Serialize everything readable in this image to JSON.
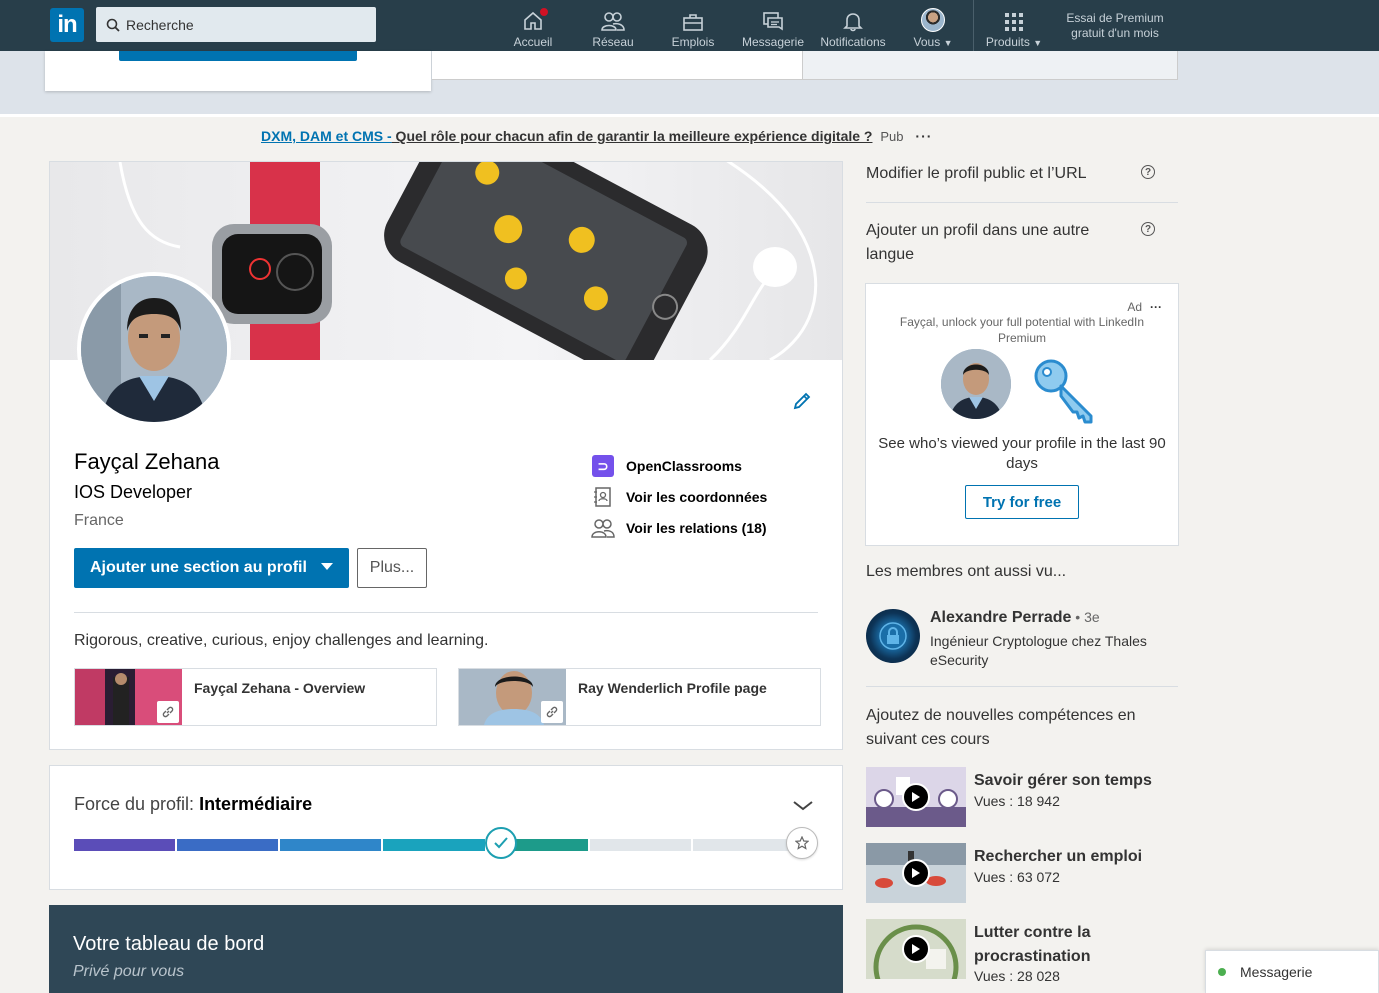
{
  "nav": {
    "logo_text": "in",
    "search_placeholder": "Recherche",
    "items": [
      {
        "label": "Accueil",
        "icon": "home-icon"
      },
      {
        "label": "Réseau",
        "icon": "network-icon"
      },
      {
        "label": "Emplois",
        "icon": "briefcase-icon"
      },
      {
        "label": "Messagerie",
        "icon": "messaging-icon"
      },
      {
        "label": "Notifications",
        "icon": "bell-icon"
      },
      {
        "label": "Vous",
        "icon": "avatar"
      },
      {
        "label": "Produits",
        "icon": "grid-icon"
      }
    ],
    "premium_line1": "Essai de Premium",
    "premium_line2": "gratuit d'un mois"
  },
  "ad_banner": {
    "part1": "DXM, DAM et CMS -",
    "part2": " Quel rôle pour chacun afin de garantir la meilleure expérience digitale ?",
    "tag": "Pub",
    "more": "···"
  },
  "profile": {
    "name": "Fayçal Zehana",
    "headline": "IOS Developer",
    "location": "France",
    "links": [
      {
        "label": "OpenClassrooms",
        "icon": "openclassrooms-icon"
      },
      {
        "label": "Voir les coordonnées",
        "icon": "contact-card-icon"
      },
      {
        "label": "Voir les relations (18)",
        "icon": "people-icon"
      }
    ],
    "add_section_label": "Ajouter une section au profil",
    "more_label": "Plus...",
    "summary": "Rigorous, creative, curious, enjoy challenges and learning.",
    "media": [
      {
        "title": "Fayçal Zehana - Overview"
      },
      {
        "title": "Ray Wenderlich Profile page"
      }
    ]
  },
  "strength": {
    "label": "Force du profil: ",
    "level": "Intermédiaire",
    "progress": 0.72,
    "segment_colors": [
      "#5b4db8",
      "#3a6cc5",
      "#2f86c9",
      "#1aa3bd",
      "#1d9b8a",
      "#e1e6ea",
      "#e1e6ea"
    ]
  },
  "dashboard": {
    "title": "Votre tableau de bord",
    "subtitle": "Privé pour vous"
  },
  "right": {
    "public_profile": "Modifier le profil public et l’URL",
    "other_language": "Ajouter un profil dans une autre langue",
    "ad": {
      "tag": "Ad",
      "more": "···",
      "line1": "Fayçal, unlock your full potential with LinkedIn Premium",
      "text": "See who’s viewed your profile in the last 90 days",
      "button": "Try for free"
    },
    "also_viewed": "Les membres ont aussi vu...",
    "person": {
      "name": "Alexandre Perrade",
      "degree": " • 3e",
      "role": "Ingénieur Cryptologue chez Thales eSecurity"
    },
    "skills_head": "Ajoutez de nouvelles compétences en suivant ces cours",
    "courses": [
      {
        "title": "Savoir gérer son temps",
        "views": "Vues : 18 942"
      },
      {
        "title": "Rechercher un emploi",
        "views": "Vues : 63 072"
      },
      {
        "title": "Lutter contre la procrastination",
        "views": "Vues : 28 028"
      }
    ]
  },
  "messaging": {
    "label": "Messagerie"
  },
  "colors": {
    "brand": "#0073b1",
    "nav_bg": "#283e4a",
    "dash_bg": "#2f4756"
  }
}
